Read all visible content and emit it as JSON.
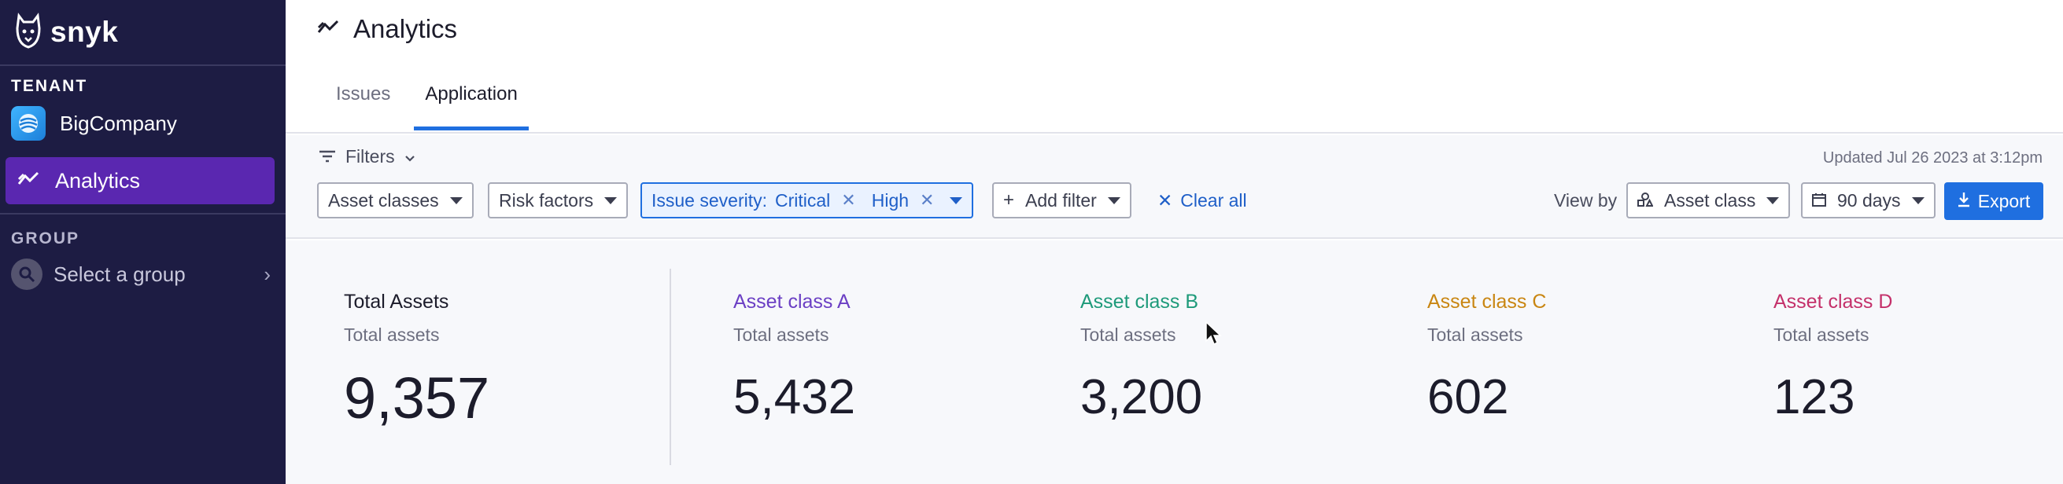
{
  "sidebar": {
    "brand": "snyk",
    "tenant_label": "TENANT",
    "tenant_name": "BigCompany",
    "nav_active": "Analytics",
    "group_label": "GROUP",
    "group_select": "Select a group"
  },
  "header": {
    "title": "Analytics",
    "tabs": [
      {
        "label": "Issues",
        "active": false
      },
      {
        "label": "Application",
        "active": true
      }
    ]
  },
  "filters": {
    "toggle_label": "Filters",
    "updated": "Updated Jul 26 2023 at 3:12pm",
    "asset_classes": "Asset classes",
    "risk_factors": "Risk factors",
    "severity_label": "Issue severity:",
    "severity_values": [
      "Critical",
      "High"
    ],
    "add_filter": "Add filter",
    "clear_all": "Clear all",
    "view_by_label": "View by",
    "view_by_value": "Asset class",
    "range": "90 days",
    "export": "Export"
  },
  "stats": {
    "total": {
      "title": "Total Assets",
      "sub": "Total assets",
      "value": "9,357"
    },
    "classes": [
      {
        "title": "Asset class A",
        "sub": "Total assets",
        "value": "5,432",
        "color": "#6b3fc4"
      },
      {
        "title": "Asset class B",
        "sub": "Total assets",
        "value": "3,200",
        "color": "#1e9a7a"
      },
      {
        "title": "Asset class C",
        "sub": "Total assets",
        "value": "602",
        "color": "#c98612"
      },
      {
        "title": "Asset class D",
        "sub": "Total assets",
        "value": "123",
        "color": "#c4306a"
      }
    ]
  },
  "colors": {
    "sidebar_bg": "#1d1c43",
    "nav_active_bg": "#5a27b0",
    "accent_blue": "#1f6fe0"
  }
}
